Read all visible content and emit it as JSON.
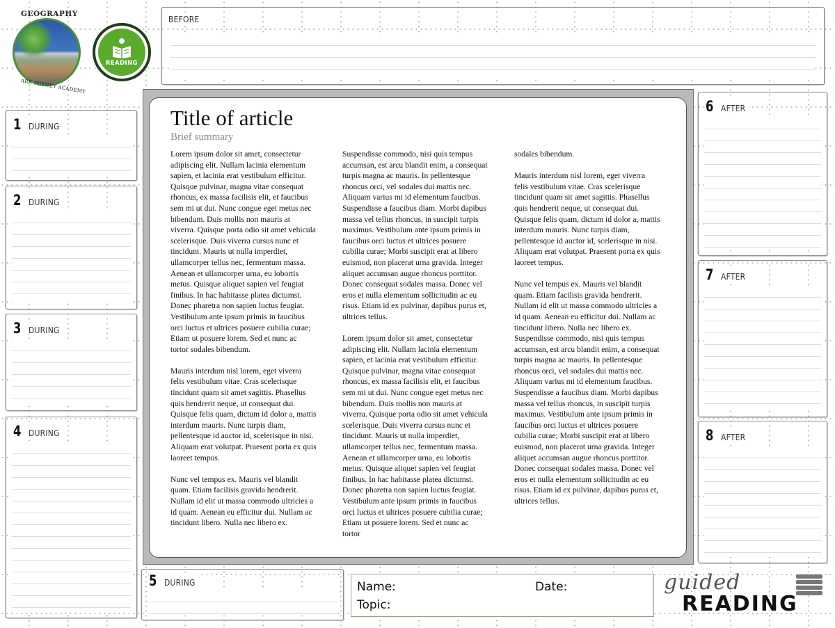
{
  "logo": {
    "school_title": "GEOGRAPHY",
    "school_subtitle": "ARK PUTNEY ACADEMY",
    "badge_label": "READING"
  },
  "boxes": {
    "before": {
      "label": "BEFORE"
    },
    "during1": {
      "num": "1",
      "label": "DURING"
    },
    "during2": {
      "num": "2",
      "label": "DURING"
    },
    "during3": {
      "num": "3",
      "label": "DURING"
    },
    "during4": {
      "num": "4",
      "label": "DURING"
    },
    "during5": {
      "num": "5",
      "label": "DURING"
    },
    "after6": {
      "num": "6",
      "label": "AFTER"
    },
    "after7": {
      "num": "7",
      "label": "AFTER"
    },
    "after8": {
      "num": "8",
      "label": "AFTER"
    }
  },
  "article": {
    "title": "Title of article",
    "summary": "Brief summary",
    "columns": [
      [
        "Lorem ipsum dolor sit amet, consectetur adipiscing elit. Nullam lacinia elementum sapien, et lacinia erat vestibulum efficitur. Quisque pulvinar, magna vitae consequat rhoncus, ex massa facilisis elit, et faucibus sem mi ut dui. Nunc congue eget metus nec bibendum. Duis mollis non mauris at viverra. Quisque porta odio sit amet vehicula scelerisque. Duis viverra cursus nunc et tincidunt. Mauris ut nulla imperdiet, ullamcorper tellus nec, fermentum massa. Aenean et ullamcorper urna, eu lobortis metus. Quisque aliquet sapien vel feugiat finibus. In hac habitasse platea dictumst. Donec pharetra non sapien luctus feugiat. Vestibulum ante ipsum primis in faucibus orci luctus et ultrices posuere cubilia curae; Etiam ut posuere lorem. Sed et nunc ac tortor sodales bibendum.",
        "Mauris interdum nisl lorem, eget viverra felis vestibulum vitae. Cras scelerisque tincidunt quam sit amet sagittis. Phasellus quis hendrerit neque, ut consequat dui. Quisque felis quam, dictum id dolor a, mattis interdum mauris. Nunc turpis diam, pellentesque id auctor id, scelerisque in nisi. Aliquam erat volutpat. Praesent porta ex quis laoreet tempus.",
        "Nunc vel tempus ex. Mauris vel blandit quam. Etiam facilisis gravida hendrerit. Nullam id elit ut massa commodo ultricies a id quam. Aenean eu efficitur dui. Nullam ac tincidunt libero. Nulla nec libero ex."
      ],
      [
        "Suspendisse commodo, nisi quis tempus accumsan, est arcu blandit enim, a consequat turpis magna ac mauris. In pellentesque rhoncus orci, vel sodales dui mattis nec. Aliquam varius mi id elementum faucibus. Suspendisse a faucibus diam. Morbi dapibus massa vel tellus rhoncus, in suscipit turpis maximus. Vestibulum ante ipsum primis in faucibus orci luctus et ultrices posuere cubilia curae; Morbi suscipit erat at libero euismod, non placerat urna gravida. Integer aliquet accumsan augue rhoncus porttitor. Donec consequat sodales massa. Donec vel eros et nulla elementum sollicitudin ac eu risus. Etiam id ex pulvinar, dapibus purus et, ultrices tellus.",
        "Lorem ipsum dolor sit amet, consectetur adipiscing elit. Nullam lacinia elementum sapien, et lacinia erat vestibulum efficitur. Quisque pulvinar, magna vitae consequat rhoncus, ex massa facilisis elit, et faucibus sem mi ut dui. Nunc congue eget metus nec bibendum. Duis mollis non mauris at viverra. Quisque porta odio sit amet vehicula scelerisque. Duis viverra cursus nunc et tincidunt. Mauris ut nulla imperdiet, ullamcorper tellus nec, fermentum massa. Aenean et ullamcorper urna, eu lobortis metus. Quisque aliquet sapien vel feugiat finibus. In hac habitasse platea dictumst. Donec pharetra non sapien luctus feugiat. Vestibulum ante ipsum primis in faucibus orci luctus et ultrices posuere cubilia curae; Etiam ut posuere lorem. Sed et nunc ac tortor"
      ],
      [
        "sodales bibendum.",
        "Mauris interdum nisl lorem, eget viverra felis vestibulum vitae. Cras scelerisque tincidunt quam sit amet sagittis. Phasellus quis hendrerit neque, ut consequat dui. Quisque felis quam, dictum id dolor a, mattis interdum mauris. Nunc turpis diam, pellentesque id auctor id, scelerisque in nisi. Aliquam erat volutpat. Praesent porta ex quis laoreet tempus.",
        "Nunc vel tempus ex. Mauris vel blandit quam. Etiam facilisis gravida hendrerit. Nullam id elit ut massa commodo ultricies a id quam. Aenean eu efficitur dui. Nullam ac tincidunt libero. Nulla nec libero ex.\nSuspendisse commodo, nisi quis tempus accumsan, est arcu blandit enim, a consequat turpis magna ac mauris. In pellentesque rhoncus orci, vel sodales dui mattis nec. Aliquam varius mi id elementum faucibus. Suspendisse a faucibus diam. Morbi dapibus massa vel tellus rhoncus, in suscipit turpis maximus. Vestibulum ante ipsum primis in faucibus orci luctus et ultrices posuere cubilia curae; Morbi suscipit erat at libero euismod, non placerat urna gravida. Integer aliquet accumsan augue rhoncus porttitor. Donec consequat sodales massa. Donec vel eros et nulla elementum sollicitudin ac eu risus. Etiam id ex pulvinar, dapibus purus et, ultrices tellus."
      ]
    ]
  },
  "footer": {
    "name_label": "Name:",
    "date_label": "Date:",
    "topic_label": "Topic:",
    "logo_top": "guided",
    "logo_bottom": "READING"
  }
}
